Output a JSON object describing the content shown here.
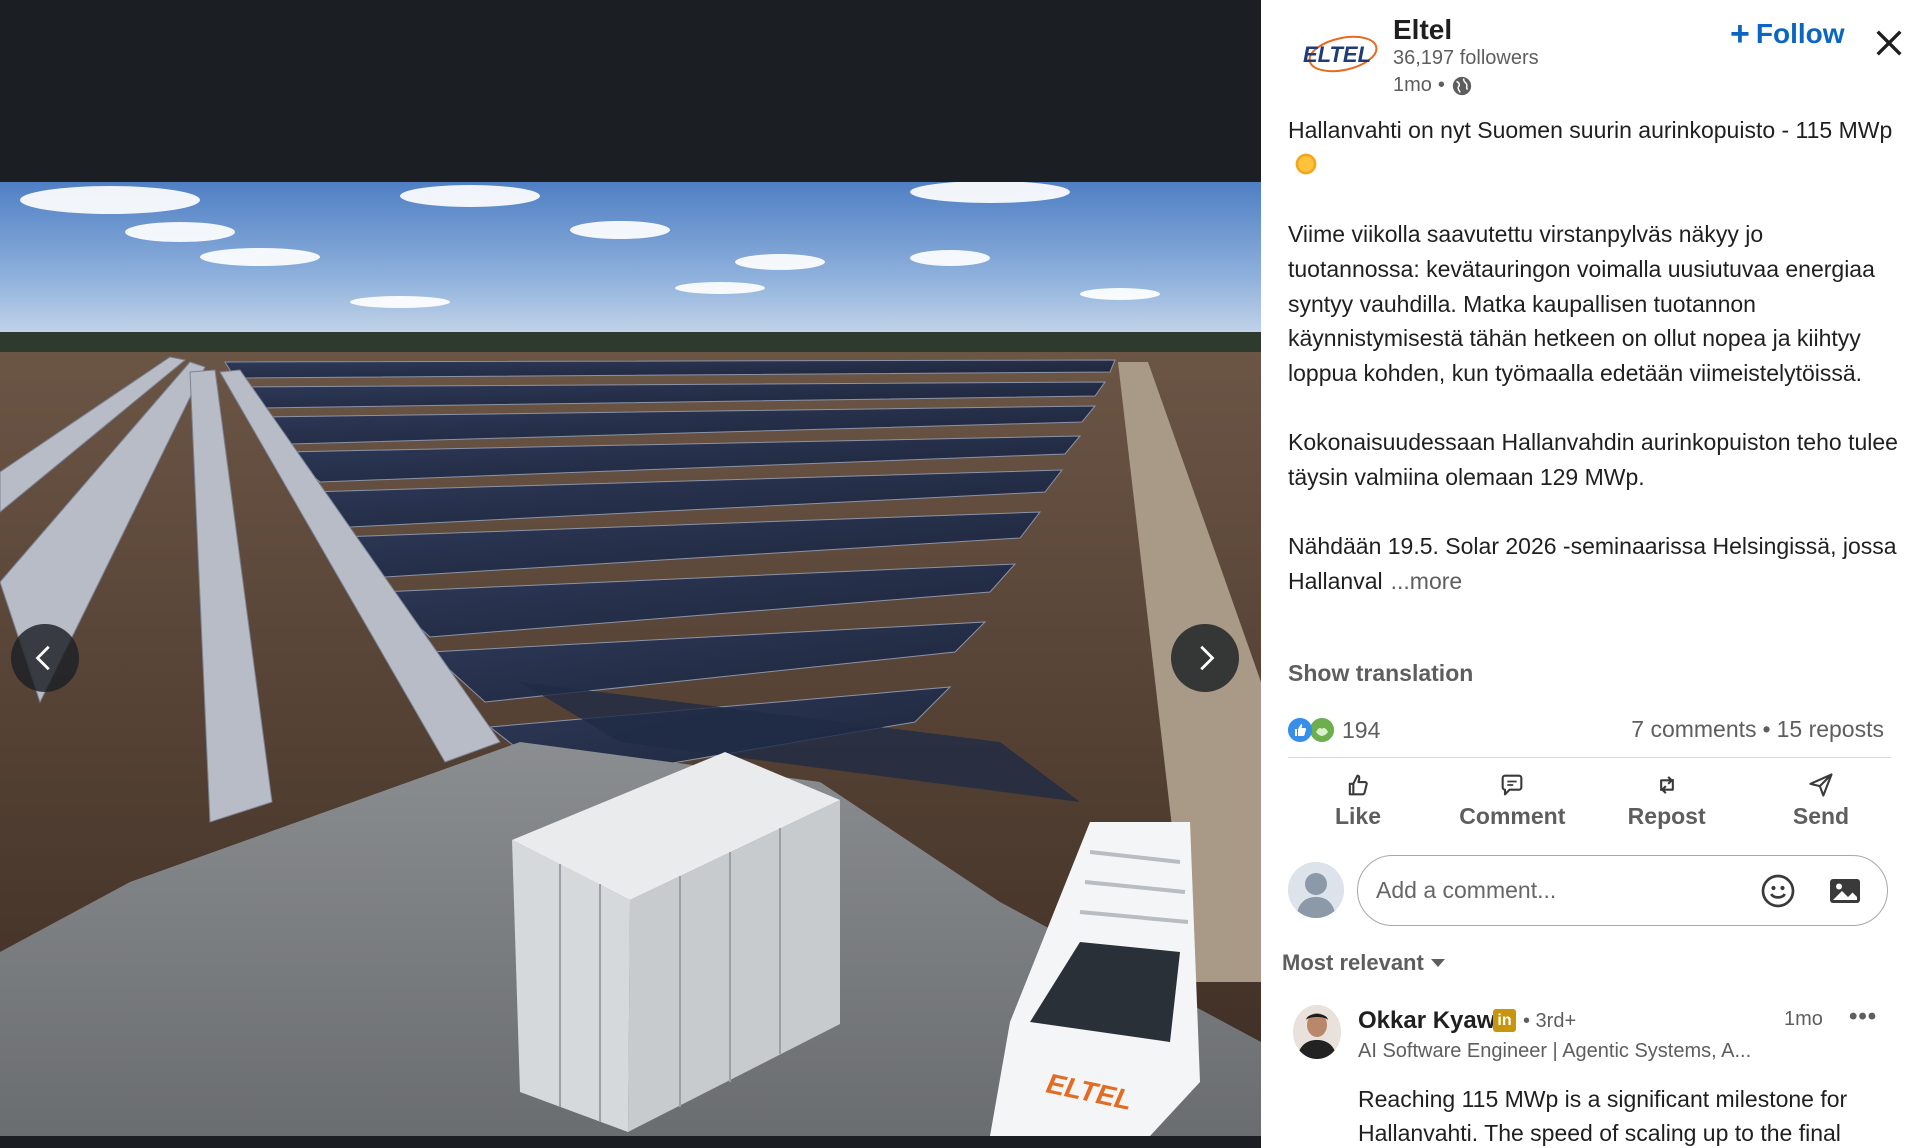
{
  "company": {
    "logo_text": "ELTEL",
    "name": "Eltel",
    "followers": "36,197 followers",
    "time": "1mo",
    "separator": "•",
    "globe_icon": "globe-icon"
  },
  "header": {
    "follow_plus": "+",
    "follow_label": "Follow",
    "close_icon": "close-icon"
  },
  "post": {
    "line1": "Hallanvahti on nyt Suomen suurin aurinkopuisto - 115 MWp",
    "sun_icon": "sun-emoji",
    "paragraph2": "Viime viikolla saavutettu virstanpylväs näkyy jo tuotannossa: kevätauringon voimalla uusiutuvaa energiaa syntyy vauhdilla. Matka kaupallisen tuotannon käynnistymisestä tähän hetkeen on ollut nopea ja kiihtyy loppua kohden, kun työmaalla edetään viimeistelytöissä.",
    "paragraph3": "Kokonaisuudessaan Hallanvahdin aurinkopuiston teho tulee täysin valmiina olemaan 129 MWp.",
    "paragraph4": "Nähdään 19.5. Solar 2026 -seminaarissa Helsingissä, jossa Hallanval",
    "more_label": "...more",
    "show_translation": "Show translation"
  },
  "social": {
    "reactions_count": "194",
    "comments": "7 comments",
    "dot": "•",
    "reposts": "15 reposts"
  },
  "actions": {
    "like": "Like",
    "comment": "Comment",
    "repost": "Repost",
    "send": "Send"
  },
  "comment_box": {
    "placeholder": "Add a comment..."
  },
  "comments_section": {
    "sort_label": "Most relevant",
    "first_comment": {
      "author": "Okkar Kyaw",
      "badge": "in",
      "degree": "• 3rd+",
      "title": "AI Software Engineer | Agentic Systems, A...",
      "time": "1mo",
      "more": "•••",
      "text": "Reaching 115 MWp is a significant milestone for Hallanvahti. The speed of scaling up to the final"
    }
  },
  "media": {
    "photo_van_label": "ELTEL",
    "prev_icon": "chevron-left-icon",
    "next_icon": "chevron-right-icon"
  },
  "colors": {
    "accent": "#0a66c2",
    "media_bg": "#1b1f23",
    "muted_text": "#5e5e5e"
  }
}
